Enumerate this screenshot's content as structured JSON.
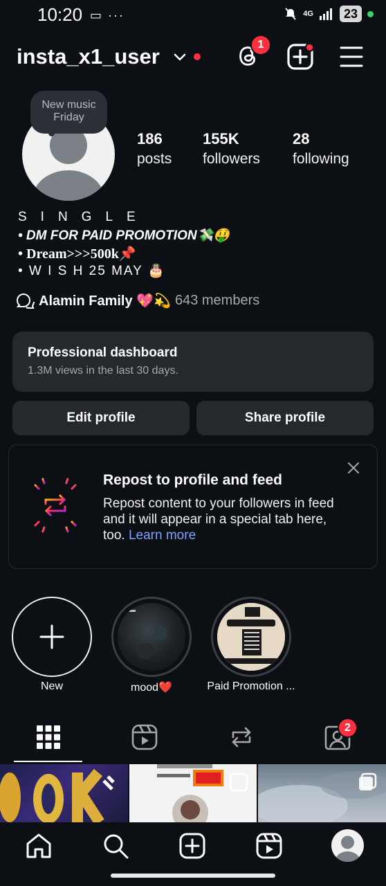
{
  "status_bar": {
    "time": "10:20",
    "left_icons": "▭ ···",
    "network": "4G",
    "battery": "23"
  },
  "header": {
    "username": "insta_x1_user",
    "threads_badge": "1"
  },
  "note": {
    "text": "New music Friday"
  },
  "stats": {
    "posts": {
      "value": "186",
      "label": "posts"
    },
    "followers": {
      "value": "155K",
      "label": "followers"
    },
    "following": {
      "value": "28",
      "label": "following"
    }
  },
  "bio": {
    "line1": "SINGLE",
    "line2": "• DM FOR PAID PROMOTION💸🤑",
    "line3": "• Dream>>>500k📌",
    "line4": "• W I S H 25    MAY 🎂"
  },
  "channel": {
    "name": "Alamin Family 💖💫",
    "members": "643 members"
  },
  "dashboard": {
    "title": "Professional dashboard",
    "subtitle": "1.3M views in the last 30 days."
  },
  "buttons": {
    "edit": "Edit profile",
    "share": "Share profile"
  },
  "repost": {
    "title": "Repost to profile and feed",
    "description": "Repost content to your followers in feed and it will appear in a special tab here, too.",
    "link": "Learn more"
  },
  "highlights": [
    {
      "label": "New"
    },
    {
      "label": "mood❤️"
    },
    {
      "label": "Paid Promotion ..."
    }
  ],
  "tabs": {
    "tagged_badge": "2"
  },
  "icons": {
    "threads": "threads-icon",
    "add": "add-icon",
    "menu": "menu-icon",
    "grid": "grid-icon",
    "reels": "reels-icon",
    "reposts": "repost-icon",
    "tagged": "tagged-icon",
    "home": "home-icon",
    "search": "search-icon",
    "create": "create-icon"
  },
  "colors": {
    "background": "#0c1014",
    "card": "#25292e",
    "badge": "#ff3040",
    "link": "#7ea0ff"
  }
}
